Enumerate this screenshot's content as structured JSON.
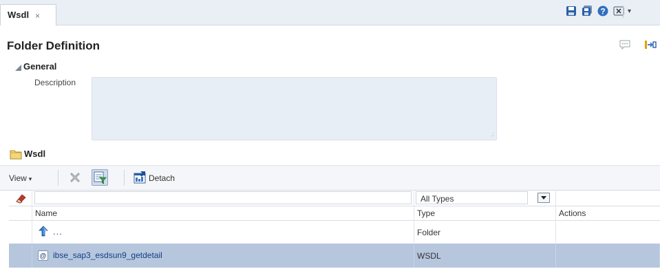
{
  "tabbar": {
    "tab_label": "Wsdl",
    "tab_close": "×",
    "menu_caret": "▾"
  },
  "header": {
    "title": "Folder Definition"
  },
  "general": {
    "title": "General",
    "description_label": "Description",
    "description_value": "",
    "resize_grip": ".:"
  },
  "folder": {
    "title": "Wsdl"
  },
  "toolbar": {
    "view_label": "View",
    "view_caret": "▾",
    "detach_label": "Detach"
  },
  "table": {
    "filter": {
      "name_value": "",
      "type_selected": "All Types"
    },
    "columns": [
      "Name",
      "Type",
      "Actions"
    ],
    "rows": [
      {
        "name": "...",
        "type": "Folder",
        "actions": ""
      },
      {
        "name": "ibse_sap3_esdsun9_getdetail",
        "type": "WSDL",
        "actions": ""
      }
    ]
  },
  "colors": {
    "accent": "#b6c6dd",
    "link": "#123f86",
    "tabbar_bg": "#eaeff5"
  },
  "icons": [
    "save-icon",
    "save-all-icon",
    "help-icon",
    "close-window-icon",
    "comment-icon",
    "connect-icon",
    "folder-icon",
    "delete-icon",
    "filter-icon",
    "detach-icon",
    "eraser-icon",
    "up-arrow-icon",
    "wsdl-icon"
  ]
}
